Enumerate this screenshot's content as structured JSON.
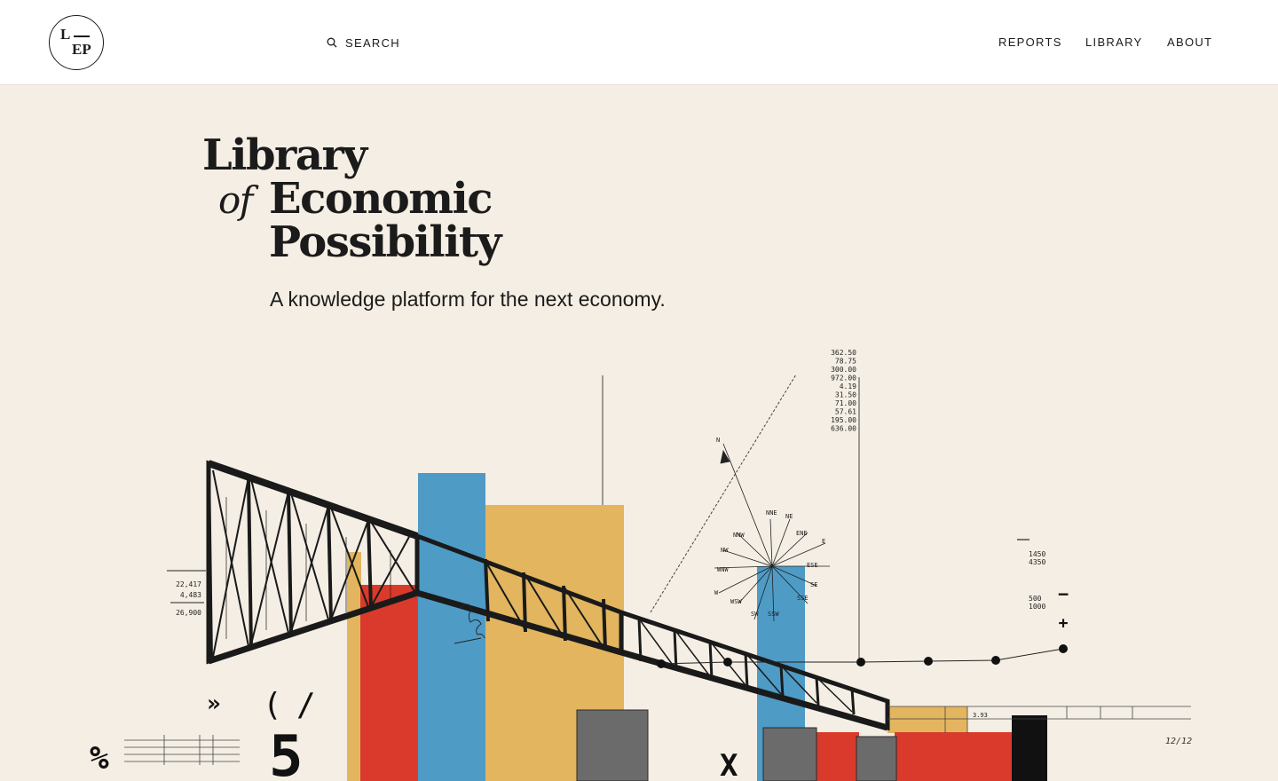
{
  "header": {
    "logo": {
      "line1": "L",
      "line2": "EP"
    },
    "search_label": "SEARCH",
    "nav": [
      "REPORTS",
      "LIBRARY",
      "ABOUT"
    ]
  },
  "hero": {
    "title_line1": "Library",
    "title_of": "of",
    "title_line2": "Economic",
    "title_line3": "Possibility",
    "tagline": "A knowledge platform for the next economy."
  },
  "illustration": {
    "figures_column": [
      "362.50",
      "78.75",
      "300.00",
      "972.00",
      "4.19",
      "31.50",
      "71.00",
      "57.61",
      "195.00",
      "636.00"
    ],
    "left_figures": [
      "22,417",
      "4,483",
      "26,900"
    ],
    "right_figures_a": [
      "1450",
      "4350"
    ],
    "right_figures_b": [
      "500",
      "1000"
    ],
    "small_label": "3.93",
    "date_mark": "12/12",
    "compass_points": [
      "N",
      "NNE",
      "NE",
      "ENE",
      "E",
      "ESE",
      "SE",
      "SSE",
      "SSW",
      "SW",
      "WSW",
      "W",
      "WNW",
      "NW",
      "NNW"
    ],
    "glyphs": {
      "quote": "»",
      "paren": "(",
      "slash": "/",
      "five": "5",
      "percent": "%",
      "x": "X",
      "minus": "−",
      "plus": "+"
    },
    "colors": {
      "red": "#d93a2b",
      "blue": "#4e9bc6",
      "yellow": "#e2b55e",
      "black": "#111111",
      "background": "#f4eee4"
    }
  }
}
